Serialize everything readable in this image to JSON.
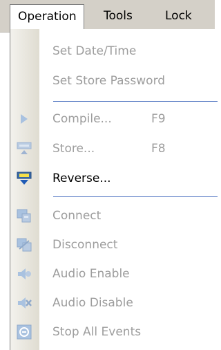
{
  "menubar": {
    "operation": "Operation",
    "tools": "Tools",
    "lock": "Lock"
  },
  "menu": {
    "set_datetime": "Set Date/Time",
    "set_store_password": "Set Store Password",
    "compile": "Compile...",
    "compile_shortcut": "F9",
    "store": "Store...",
    "store_shortcut": "F8",
    "reverse": "Reverse...",
    "connect": "Connect",
    "disconnect": "Disconnect",
    "audio_enable": "Audio Enable",
    "audio_disable": "Audio Disable",
    "stop_all_events": "Stop All Events"
  },
  "icons": {
    "compile": "play-arrow-icon",
    "store": "store-to-device-icon",
    "reverse": "reverse-from-device-icon",
    "connect": "connect-icon",
    "disconnect": "disconnect-icon",
    "audio_enable": "speaker-icon",
    "audio_disable": "speaker-muted-icon",
    "stop_all_events": "stop-icon"
  },
  "colors": {
    "menubar_bg": "#d4d0c8",
    "separator": "#4a6fbf",
    "disabled_text": "#9d9d9d",
    "disabled_icon": "#a9c2e0"
  }
}
